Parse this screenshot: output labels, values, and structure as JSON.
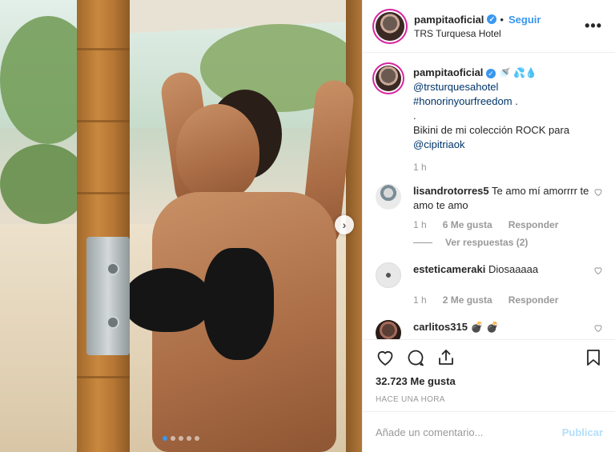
{
  "post": {
    "username": "pampitaoficial",
    "follow_label": "Seguir",
    "location": "TRS Turquesa Hotel",
    "more_icon": "more-icon",
    "verified_icon": "verified-badge-icon"
  },
  "media": {
    "alt": "photo",
    "carousel_count": 5,
    "carousel_active": 0,
    "next_icon": "chevron-right-icon"
  },
  "caption": {
    "username": "pampitaoficial",
    "emojis": "🚿 💦💧",
    "line1": "@trsturquesahotel",
    "line2": "#honorinyourfreedom .",
    "line3": ".",
    "line4": "Bikini de mi colección ROCK para",
    "line5": "@cipitriaok",
    "time": "1 h"
  },
  "comments": [
    {
      "username": "lisandrotorres5",
      "text": "Te amo mí amorrrr te amo te amo",
      "time": "1 h",
      "likes": "6 Me gusta",
      "reply": "Responder",
      "view_replies": "Ver respuestas (2)"
    },
    {
      "username": "esteticameraki",
      "text": "Diosaaaaa",
      "time": "1 h",
      "likes": "2 Me gusta",
      "reply": "Responder"
    },
    {
      "username": "carlitos315",
      "text": "💣 💣"
    }
  ],
  "actions": {
    "like_icon": "heart-icon",
    "comment_icon": "comment-icon",
    "share_icon": "share-icon",
    "save_icon": "bookmark-icon",
    "likes_count": "32.723 Me gusta",
    "posted_time": "HACE UNA HORA"
  },
  "composer": {
    "placeholder": "Añade un comentario...",
    "publish_label": "Publicar"
  },
  "colors": {
    "accent": "#3897f0",
    "link": "#003569",
    "muted": "#999999",
    "publish_disabled": "#b2dffc"
  }
}
